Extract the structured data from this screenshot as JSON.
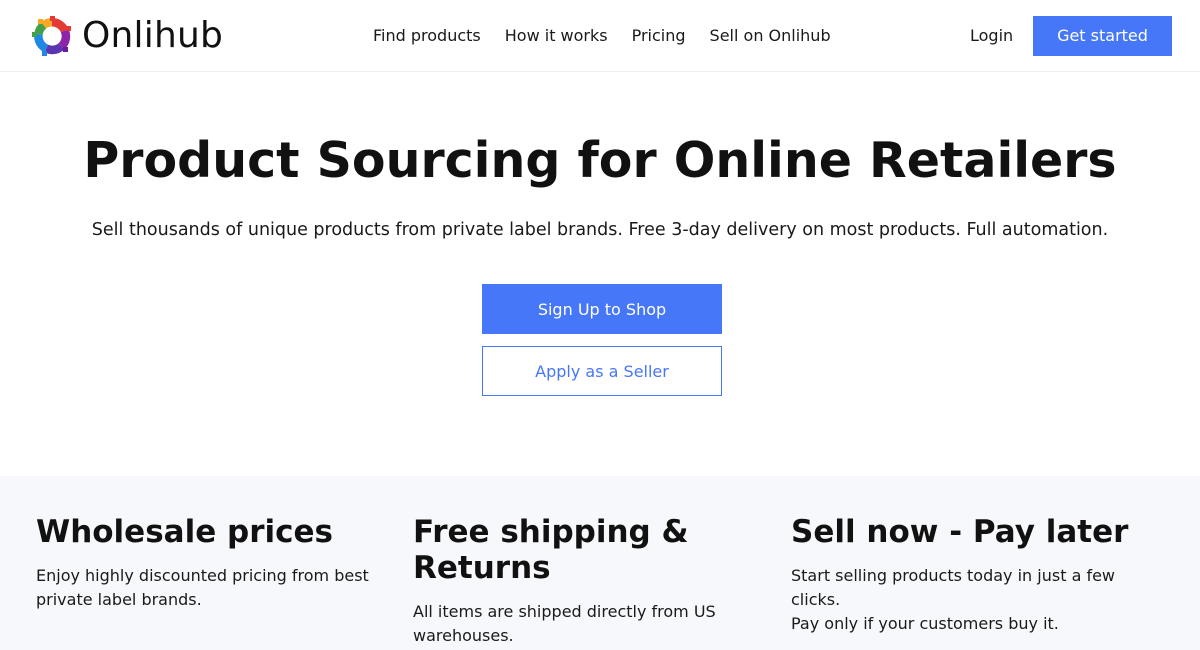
{
  "header": {
    "brand": "Onlihub",
    "nav": [
      {
        "label": "Find products"
      },
      {
        "label": "How it works"
      },
      {
        "label": "Pricing"
      },
      {
        "label": "Sell on Onlihub"
      }
    ],
    "login_label": "Login",
    "cta_label": "Get started"
  },
  "hero": {
    "title": "Product Sourcing for Online Retailers",
    "subtitle": "Sell thousands of unique products from private label brands. Free 3-day delivery on most products. Full automation.",
    "primary_button": "Sign Up to Shop",
    "secondary_button": "Apply as a Seller"
  },
  "features": [
    {
      "title": "Wholesale prices",
      "text_lines": [
        "Enjoy highly discounted pricing from best",
        "private label brands."
      ]
    },
    {
      "title": "Free shipping & Returns",
      "text_lines": [
        "All items are shipped directly from US",
        "warehouses."
      ]
    },
    {
      "title": "Sell now - Pay later",
      "text_lines": [
        "Start selling products today in just a few",
        "clicks.",
        "Pay only if your customers buy it."
      ]
    }
  ],
  "colors": {
    "accent": "#4677f8",
    "features_bg": "#f7f8fb",
    "logo_segments": [
      "#e53935",
      "#f9a825",
      "#43a047",
      "#1e88e5",
      "#6a1b9a"
    ]
  },
  "icons": {
    "logo": "multicolor-gear-ring-icon"
  }
}
